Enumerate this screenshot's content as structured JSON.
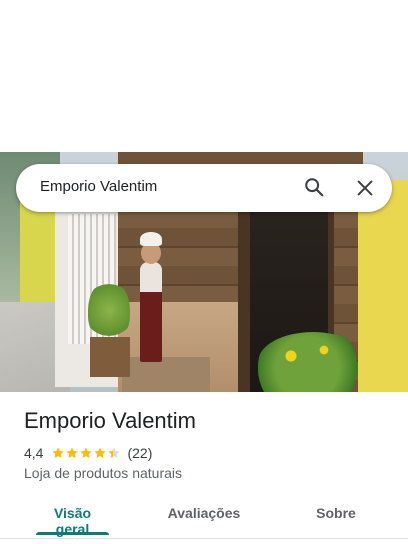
{
  "search": {
    "query": "Emporio Valentim"
  },
  "place": {
    "name": "Emporio Valentim",
    "rating": "4,4",
    "rating_value": 4.4,
    "review_count": "(22)",
    "category": "Loja de produtos naturais"
  },
  "tabs": [
    {
      "label": "Visão geral",
      "active": true
    },
    {
      "label": "Avaliações",
      "active": false
    },
    {
      "label": "Sobre",
      "active": false
    }
  ],
  "colors": {
    "accent": "#0b7c79",
    "star": "#fbbc04"
  },
  "icons": {
    "search": "search-icon",
    "close": "close-icon",
    "star": "star-icon"
  }
}
